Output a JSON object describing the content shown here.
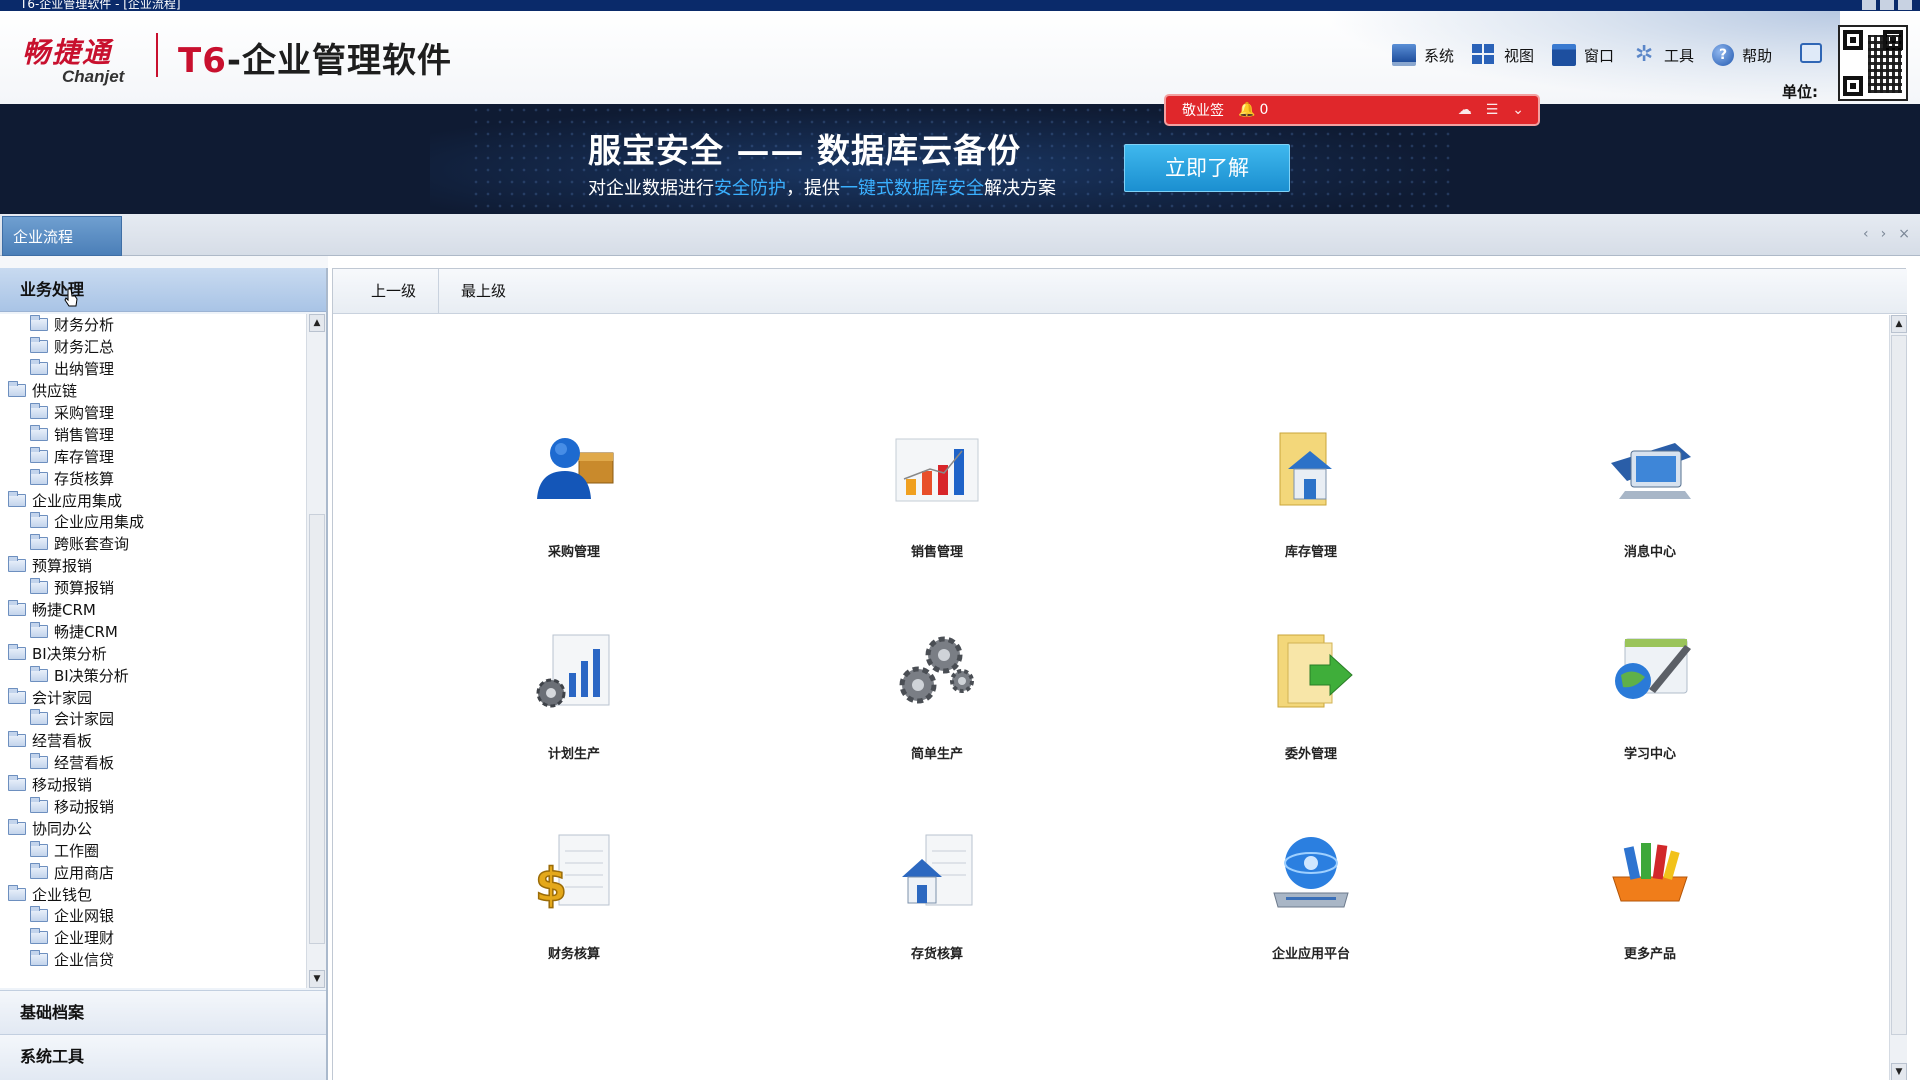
{
  "window": {
    "title": "T6-企业管理软件 - [企业流程]"
  },
  "brand": {
    "logo_cn": "畅捷通",
    "logo_en": "Chanjet",
    "product_prefix": "T6",
    "product_suffix": "-企业管理软件"
  },
  "menu": {
    "items": [
      {
        "label": "系统",
        "icon": "monitor-icon"
      },
      {
        "label": "视图",
        "icon": "view-grid-icon"
      },
      {
        "label": "窗口",
        "icon": "window-icon"
      },
      {
        "label": "工具",
        "icon": "gear-tools-icon"
      },
      {
        "label": "帮助",
        "icon": "help-icon"
      }
    ],
    "unit_label": "单位:"
  },
  "banner": {
    "title": "服宝安全 —— 数据库云备份",
    "sub_1": "对企业数据进行",
    "sub_hl_1": "安全防护",
    "sub_2": "，提供",
    "sub_hl_2": "一键式数据库安全",
    "sub_3": "解决方案",
    "button": "立即了解"
  },
  "alert": {
    "label": "敬业签",
    "count": "0"
  },
  "tabs": {
    "active": "企业流程",
    "controls": [
      "‹",
      "›",
      "×"
    ]
  },
  "left": {
    "sections": {
      "business": "业务处理",
      "archives": "基础档案",
      "systools": "系统工具"
    },
    "tree": [
      {
        "label": "财务分析",
        "level": 1
      },
      {
        "label": "财务汇总",
        "level": 1
      },
      {
        "label": "出纳管理",
        "level": 1
      },
      {
        "label": "供应链",
        "level": 0
      },
      {
        "label": "采购管理",
        "level": 1
      },
      {
        "label": "销售管理",
        "level": 1
      },
      {
        "label": "库存管理",
        "level": 1
      },
      {
        "label": "存货核算",
        "level": 1
      },
      {
        "label": "企业应用集成",
        "level": 0
      },
      {
        "label": "企业应用集成",
        "level": 1
      },
      {
        "label": "跨账套查询",
        "level": 1
      },
      {
        "label": "预算报销",
        "level": 0
      },
      {
        "label": "预算报销",
        "level": 1
      },
      {
        "label": "畅捷CRM",
        "level": 0
      },
      {
        "label": "畅捷CRM",
        "level": 1
      },
      {
        "label": "BI决策分析",
        "level": 0
      },
      {
        "label": "BI决策分析",
        "level": 1
      },
      {
        "label": "会计家园",
        "level": 0
      },
      {
        "label": "会计家园",
        "level": 1
      },
      {
        "label": "经营看板",
        "level": 0
      },
      {
        "label": "经营看板",
        "level": 1
      },
      {
        "label": "移动报销",
        "level": 0
      },
      {
        "label": "移动报销",
        "level": 1
      },
      {
        "label": "协同办公",
        "level": 0
      },
      {
        "label": "工作圈",
        "level": 1
      },
      {
        "label": "应用商店",
        "level": 1
      },
      {
        "label": "企业钱包",
        "level": 0
      },
      {
        "label": "企业网银",
        "level": 1
      },
      {
        "label": "企业理财",
        "level": 1
      },
      {
        "label": "企业信贷",
        "level": 1
      }
    ]
  },
  "toolbar": {
    "up": "上一级",
    "top": "最上级"
  },
  "modules": [
    {
      "label": "采购管理",
      "icon": "purchase-person-icon"
    },
    {
      "label": "销售管理",
      "icon": "sales-chart-icon"
    },
    {
      "label": "库存管理",
      "icon": "inventory-folder-icon"
    },
    {
      "label": "消息中心",
      "icon": "message-monitor-icon"
    },
    {
      "label": "计划生产",
      "icon": "plan-production-icon"
    },
    {
      "label": "简单生产",
      "icon": "gears-icon"
    },
    {
      "label": "委外管理",
      "icon": "outsource-folder-icon"
    },
    {
      "label": "学习中心",
      "icon": "learning-globe-icon"
    },
    {
      "label": "财务核算",
      "icon": "finance-dollar-icon"
    },
    {
      "label": "存货核算",
      "icon": "stock-house-icon"
    },
    {
      "label": "企业应用平台",
      "icon": "platform-disc-icon"
    },
    {
      "label": "更多产品",
      "icon": "more-products-icon"
    }
  ]
}
